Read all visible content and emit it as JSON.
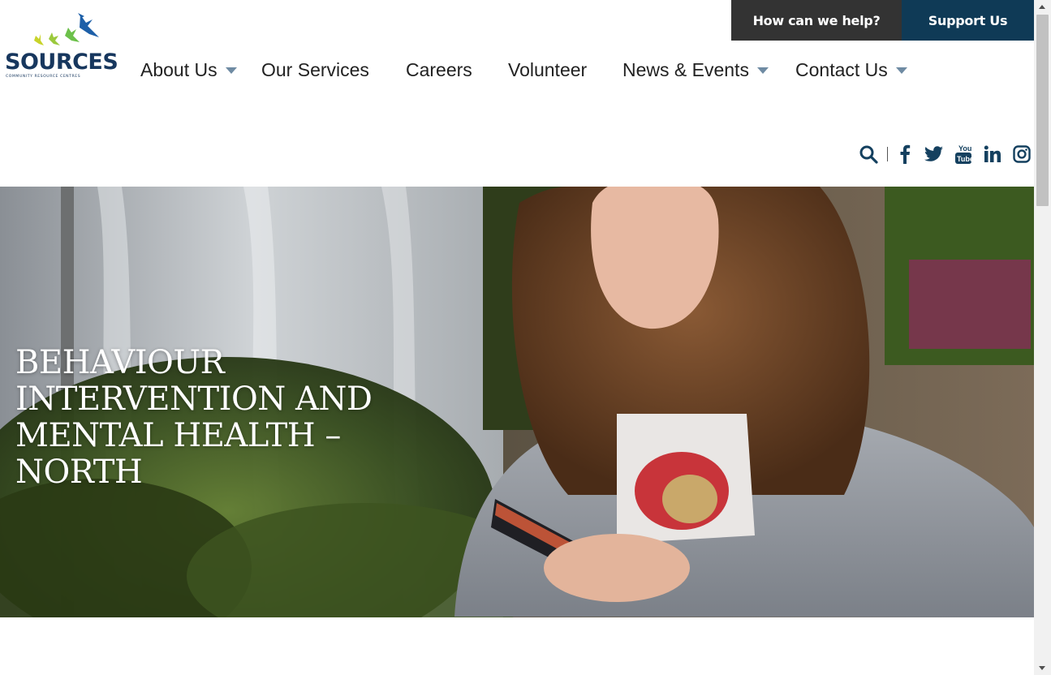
{
  "topbar": {
    "help_label": "How can we help?",
    "support_label": "Support Us",
    "help_bg": "#333333",
    "support_bg": "#0f3a56"
  },
  "logo": {
    "wordmark": "SOURCES",
    "tagline": "COMMUNITY RESOURCE CENTRES",
    "bird_colors": [
      "#c8d32a",
      "#6cc04a",
      "#1d5fa8"
    ]
  },
  "nav": {
    "items": [
      {
        "label": "About Us",
        "has_dropdown": true
      },
      {
        "label": "Our Services",
        "has_dropdown": false
      },
      {
        "label": "Careers",
        "has_dropdown": false
      },
      {
        "label": "Volunteer",
        "has_dropdown": false
      },
      {
        "label": "News & Events",
        "has_dropdown": true
      },
      {
        "label": "Contact Us",
        "has_dropdown": true
      }
    ]
  },
  "icons": [
    "search-icon",
    "facebook-icon",
    "twitter-icon",
    "youtube-icon",
    "linkedin-icon",
    "instagram-icon"
  ],
  "icon_color": "#14405f",
  "hero": {
    "title": "BEHAVIOUR INTERVENTION AND MENTAL HEALTH – NORTH"
  }
}
